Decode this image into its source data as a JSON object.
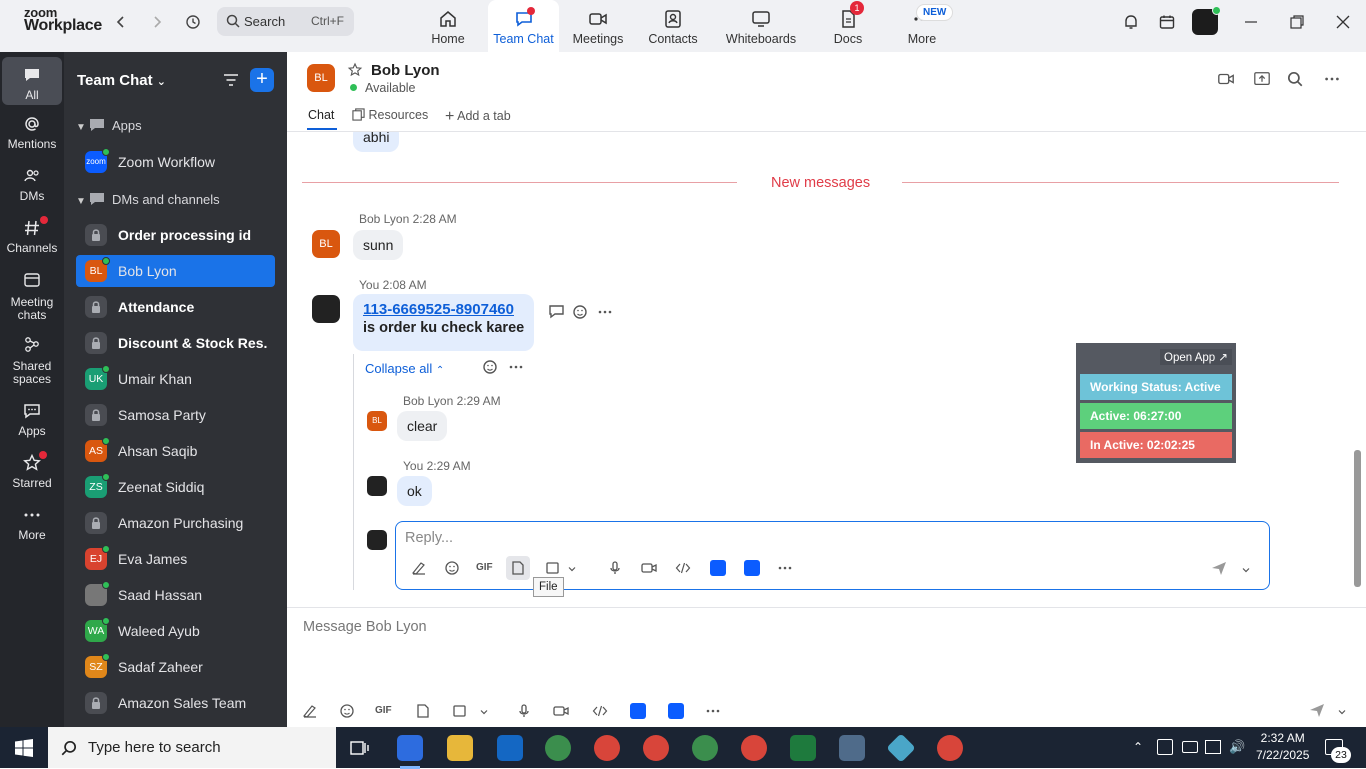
{
  "app": {
    "logo_line1": "zoom",
    "logo_line2": "Workplace"
  },
  "search": {
    "label": "Search",
    "shortcut": "Ctrl+F"
  },
  "top_tabs": [
    {
      "label": "Home",
      "icon": "home-icon"
    },
    {
      "label": "Team Chat",
      "icon": "chat-icon"
    },
    {
      "label": "Meetings",
      "icon": "video-icon"
    },
    {
      "label": "Contacts",
      "icon": "contact-icon"
    },
    {
      "label": "Whiteboards",
      "icon": "whiteboard-icon"
    },
    {
      "label": "Docs",
      "icon": "doc-icon",
      "badge": "1"
    },
    {
      "label": "More",
      "icon": "more-icon",
      "badge": "NEW"
    }
  ],
  "rail": [
    {
      "label": "All"
    },
    {
      "label": "Mentions"
    },
    {
      "label": "DMs"
    },
    {
      "label": "Channels"
    },
    {
      "label": "Meeting chats"
    },
    {
      "label": "Shared spaces"
    },
    {
      "label": "Apps"
    },
    {
      "label": "Starred"
    },
    {
      "label": "More"
    }
  ],
  "sidebar": {
    "title": "Team Chat",
    "sections": {
      "apps": "Apps",
      "dms": "DMs and channels"
    },
    "items": [
      {
        "name": "Zoom Workflow",
        "initials": "zoom",
        "color": "#0b5cff",
        "bold": false
      },
      {
        "name": "Order processing id",
        "initials": "",
        "color": "",
        "bold": true,
        "lock": true
      },
      {
        "name": "Bob Lyon",
        "initials": "BL",
        "color": "#d9570f",
        "bold": false,
        "selected": true
      },
      {
        "name": "Attendance",
        "initials": "",
        "color": "",
        "bold": true,
        "lock": true
      },
      {
        "name": "Discount & Stock Res...",
        "initials": "",
        "color": "",
        "bold": true,
        "lock": true
      },
      {
        "name": "Umair Khan",
        "initials": "UK",
        "color": "#1a9e74",
        "bold": false
      },
      {
        "name": "Samosa Party",
        "initials": "",
        "color": "",
        "bold": false,
        "lock": true
      },
      {
        "name": "Ahsan Saqib",
        "initials": "AS",
        "color": "#d9570f",
        "bold": false
      },
      {
        "name": "Zeenat Siddiq",
        "initials": "ZS",
        "color": "#1a9e74",
        "bold": false
      },
      {
        "name": "Amazon Purchasing",
        "initials": "",
        "color": "",
        "bold": false,
        "lock": true
      },
      {
        "name": "Eva James",
        "initials": "EJ",
        "color": "#d9432f",
        "bold": false
      },
      {
        "name": "Saad Hassan",
        "initials": "",
        "color": "#777",
        "bold": false,
        "photo": true
      },
      {
        "name": "Waleed Ayub",
        "initials": "WA",
        "color": "#2fa84a",
        "bold": false
      },
      {
        "name": "Sadaf Zaheer",
        "initials": "SZ",
        "color": "#e0871a",
        "bold": false
      },
      {
        "name": "Amazon Sales Team",
        "initials": "",
        "color": "",
        "bold": false,
        "lock": true
      }
    ]
  },
  "chat": {
    "contact_initials": "BL",
    "contact_name": "Bob Lyon",
    "status": "Available",
    "tabs": {
      "chat": "Chat",
      "resources": "Resources",
      "add": "Add a tab"
    }
  },
  "messages": {
    "prev_text": "abhi",
    "new_messages_label": "New messages",
    "m1": {
      "sender": "Bob Lyon",
      "time": "2:28 AM",
      "text": "sunn"
    },
    "m2": {
      "sender": "You",
      "time": "2:08 AM",
      "link": "113-6669525-8907460",
      "text": "is order ku check karee"
    },
    "collapse_label": "Collapse all",
    "r1": {
      "sender": "Bob Lyon",
      "time": "2:29 AM",
      "text": "clear"
    },
    "r2": {
      "sender": "You",
      "time": "2:29 AM",
      "text": "ok"
    }
  },
  "reply": {
    "placeholder": "Reply...",
    "tooltip": "File"
  },
  "widget": {
    "open_label": "Open App ↗",
    "working_status": "Working Status: Active",
    "active": "Active: 06:27:00",
    "inactive": "In Active: 02:02:25",
    "colors": {
      "status": "#6ec3d8",
      "active": "#5dd07c",
      "inactive": "#e96a63"
    }
  },
  "composer": {
    "placeholder": "Message Bob Lyon"
  },
  "taskbar": {
    "search_placeholder": "Type here to search",
    "time": "2:32 AM",
    "date": "7/22/2025",
    "notifications": "23"
  },
  "colors": {
    "accent": "#0e5fd8",
    "sidebar_bg": "#2f3136",
    "rail_bg": "#24262b"
  }
}
